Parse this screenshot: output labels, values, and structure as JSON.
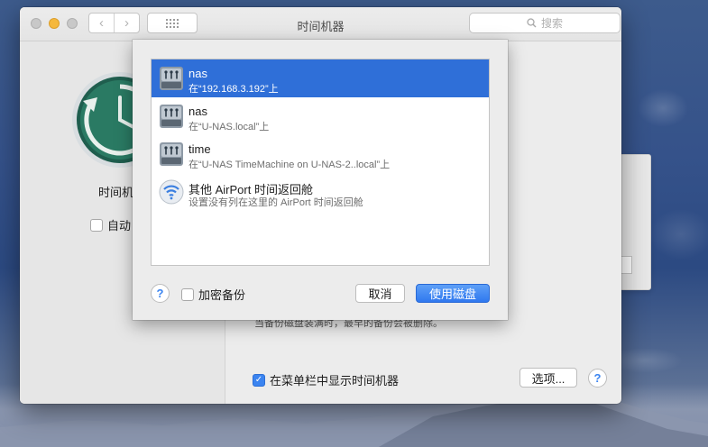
{
  "window": {
    "title": "时间机器",
    "search_placeholder": "搜索"
  },
  "left_panel": {
    "label": "时间机",
    "auto_backup_label": "自动",
    "auto_backup_checked": false
  },
  "right_panel": {
    "hint_text": "当备份磁盘装满时，最早的备份会被删除。",
    "menubar_label": "在菜单栏中显示时间机器",
    "menubar_checked": true,
    "options_label": "选项...",
    "help_label": "?"
  },
  "sheet": {
    "disks": [
      {
        "name": "nas",
        "sub": "在“192.168.3.192”上",
        "icon": "network-drive-icon",
        "selected": true
      },
      {
        "name": "nas",
        "sub": "在“U-NAS.local”上",
        "icon": "network-drive-icon",
        "selected": false
      },
      {
        "name": "time",
        "sub": "在“U-NAS TimeMachine on U-NAS-2..local”上",
        "icon": "network-drive-icon",
        "selected": false
      },
      {
        "name": "其他 AirPort 时间返回舱",
        "sub": "设置没有列在这里的 AirPort 时间返回舱",
        "icon": "wifi-icon",
        "selected": false
      }
    ],
    "help_label": "?",
    "encrypt_label": "加密备份",
    "encrypt_checked": false,
    "cancel_label": "取消",
    "use_disk_label": "使用磁盘"
  },
  "colors": {
    "selection": "#2f6fd8",
    "accent": "#3b84f0"
  }
}
